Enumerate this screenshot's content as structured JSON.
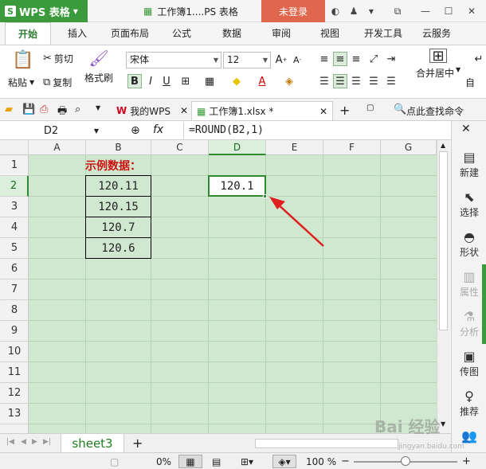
{
  "titlebar": {
    "app_name": "WPS 表格",
    "app_logo": "S",
    "doc_title": "工作簿1....PS 表格",
    "login_label": "未登录",
    "icons": [
      "skin-icon",
      "shirt-icon",
      "dropdown-icon",
      "restore-icon",
      "minimize-icon",
      "maximize-icon",
      "close-icon"
    ]
  },
  "ribbon_tabs": [
    "开始",
    "插入",
    "页面布局",
    "公式",
    "数据",
    "审阅",
    "视图",
    "开发工具",
    "云服务"
  ],
  "active_tab": "开始",
  "ribbon": {
    "paste_label": "粘贴",
    "cut_label": "剪切",
    "copy_label": "复制",
    "format_painter_label": "格式刷",
    "font_name": "宋体",
    "font_size": "12",
    "bold": "B",
    "italic": "I",
    "underline": "U",
    "merge_center_label": "合并居中",
    "autowrap_label": "自"
  },
  "doc_tabs": {
    "my_wps_label": "我的WPS",
    "file_tab_label": "工作簿1.xlsx *",
    "new_tab": "+",
    "search_label": "点此查找命令"
  },
  "formula_bar": {
    "name_box": "D2",
    "fx": "fx",
    "formula": "=ROUND(B2,1)"
  },
  "columns": [
    "A",
    "B",
    "C",
    "D",
    "E",
    "F",
    "G"
  ],
  "selected_column": "D",
  "rows": [
    "1",
    "2",
    "3",
    "4",
    "5",
    "6",
    "7",
    "8",
    "9",
    "10",
    "11",
    "12",
    "13"
  ],
  "selected_row": "2",
  "sheet_cells": {
    "title": "示例数据：",
    "b2": "120.11",
    "b3": "120.15",
    "b4": "120.7",
    "b5": "120.6",
    "d2": "120.1"
  },
  "right_panel": [
    {
      "label": "新建",
      "icon": "new-icon",
      "enabled": true
    },
    {
      "label": "选择",
      "icon": "select-icon",
      "enabled": true
    },
    {
      "label": "形状",
      "icon": "shape-icon",
      "enabled": true
    },
    {
      "label": "属性",
      "icon": "properties-icon",
      "enabled": false
    },
    {
      "label": "分析",
      "icon": "analysis-icon",
      "enabled": false
    },
    {
      "label": "传图",
      "icon": "upload-image-icon",
      "enabled": true
    },
    {
      "label": "推荐",
      "icon": "recommend-icon",
      "enabled": true
    }
  ],
  "sheet_tab": "sheet3",
  "status_bar": {
    "progress": "0%",
    "zoom": "100 %",
    "zoom_fraction": 0.5
  },
  "watermark": {
    "brand": "Bai 经验",
    "url": "jingyan.baidu.com"
  },
  "colors": {
    "accent_green": "#3b9a3b",
    "sheet_bg": "#cfe8cf",
    "login_red": "#e0664e",
    "title_red": "#cc1111",
    "arrow_red": "#e02020"
  }
}
